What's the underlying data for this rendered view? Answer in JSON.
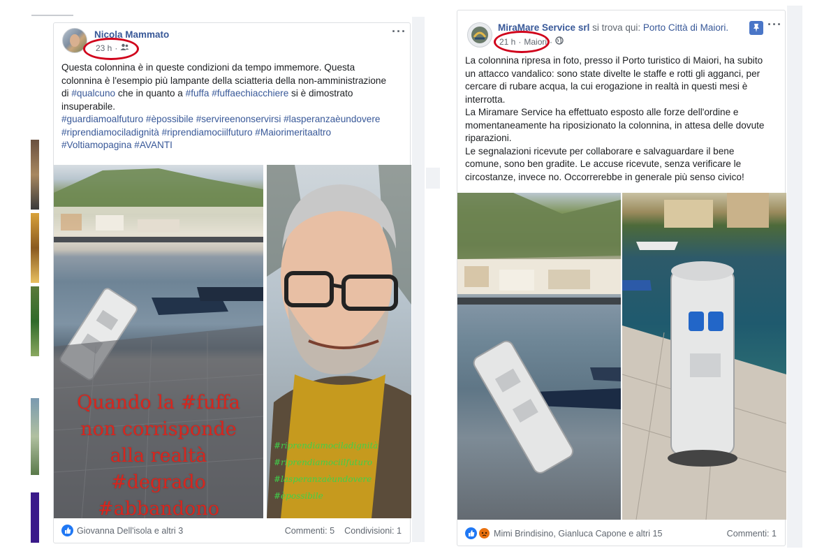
{
  "post1": {
    "author": "Nicola Mammato",
    "time": "23 h",
    "audience_icon": "friends-icon",
    "more_icon": "more-options-icon",
    "text_lines": [
      [
        {
          "t": "Questa colonnina è in queste condizioni da tempo immemore. Questa"
        }
      ],
      [
        {
          "t": "colonnina è l'esempio più lampante della sciatteria della non-amministrazione"
        }
      ],
      [
        {
          "t": "di "
        },
        {
          "t": "#qualcuno",
          "tag": true
        },
        {
          "t": " che in quanto a "
        },
        {
          "t": "#fuffa",
          "tag": true
        },
        {
          "t": " "
        },
        {
          "t": "#fuffaechiacchiere",
          "tag": true
        },
        {
          "t": " si è dimostrato"
        }
      ],
      [
        {
          "t": "insuperabile."
        }
      ],
      [
        {
          "t": "#guardiamoalfuturo #èpossibile #servireenonservirsi #lasperanzaèundovere",
          "tag": true
        }
      ],
      [
        {
          "t": "#riprendiamociladignità #riprendiamociilfuturo #Maiorimeritaaltro",
          "tag": true
        }
      ],
      [
        {
          "t": "#Voltiamopagina #AVANTI",
          "tag": true
        }
      ]
    ],
    "image_left_overlay": [
      "Quando la #fuffa",
      "non corrisponde",
      "alla realtà",
      "#degrado",
      "#abbandono"
    ],
    "image_right_overlay": [
      "#riprendiamociladignità",
      "#riprendiamociilfuturo",
      "#lasperanzaèundovere",
      "#èpossibile"
    ],
    "reactions_text": "Giovanna Dell'isola e altri 3",
    "comments": "Commenti: 5",
    "shares": "Condivisioni: 1"
  },
  "post2": {
    "author": "MiraMare Service srl",
    "author_suffix": " si trova qui: ",
    "place": "Porto Città di Maiori.",
    "time": "21 h",
    "location": "Maiori",
    "audience_icon": "globe-icon",
    "pin_icon": "pin-icon",
    "more_icon": "more-options-icon",
    "text_lines": [
      "La colonnina ripresa in foto, presso il Porto turistico di Maiori, ha subito",
      "un attacco vandalico: sono state divelte le staffe e rotti gli agganci, per",
      "cercare di rubare acqua, la cui erogazione in realtà in questi mesi è",
      "interrotta.",
      "La Miramare Service ha effettuato esposto alle forze dell'ordine e",
      "momentaneamente ha riposizionato la colonnina, in attesa delle dovute",
      "riparazioni.",
      "Le segnalazioni ricevute per collaborare e salvaguardare il bene",
      "comune, sono ben gradite. Le accuse ricevute, senza verificare le",
      "circostanze, invece no. Occorrerebbe in generale più senso civico!"
    ],
    "reactions_text": "Mimi Brindisino, Gianluca Capone e altri 15",
    "comments": "Commenti: 1"
  },
  "colors": {
    "link": "#385898",
    "highlight_circle": "#d0021b",
    "like": "#2078f4",
    "angry": "#e9710f",
    "overlay_red": "#d9251d",
    "overlay_green": "#3fd14a"
  }
}
